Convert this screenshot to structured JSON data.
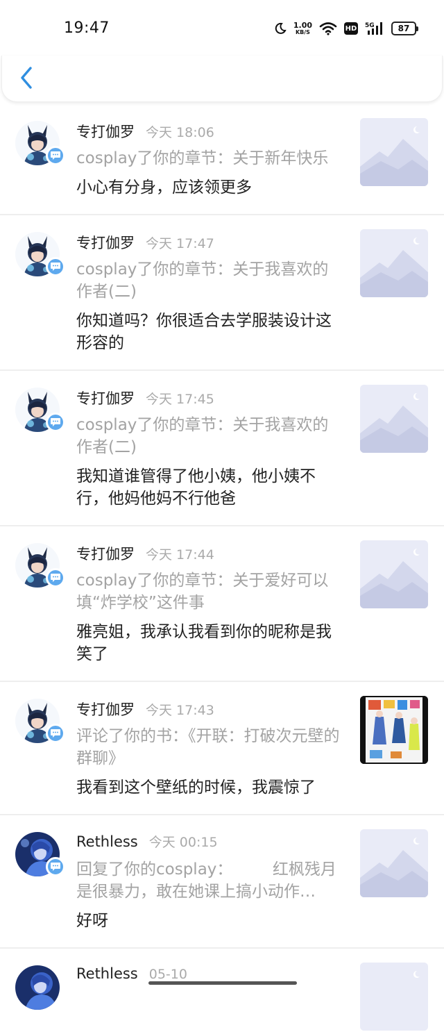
{
  "status_bar": {
    "time": "19:47",
    "net_speed_value": "1.00",
    "net_speed_unit": "KB/S",
    "hd": "HD",
    "signal": "5G",
    "battery": "87"
  },
  "notifications": [
    {
      "name": "专打伽罗",
      "time": "今天 18:06",
      "desc": "cosplay了你的章节：关于新年快乐",
      "message": "小心有分身，应该领更多",
      "avatar": "anime",
      "thumb": "placeholder"
    },
    {
      "name": "专打伽罗",
      "time": "今天 17:47",
      "desc": "cosplay了你的章节：关于我喜欢的作者(二)",
      "message": "你知道吗？你很适合去学服装设计这形容的",
      "avatar": "anime",
      "thumb": "placeholder"
    },
    {
      "name": "专打伽罗",
      "time": "今天 17:45",
      "desc": "cosplay了你的章节：关于我喜欢的作者(二)",
      "message": "我知道谁管得了他小姨，他小姨不行，他妈他妈不行他爸",
      "avatar": "anime",
      "thumb": "placeholder"
    },
    {
      "name": "专打伽罗",
      "time": "今天 17:44",
      "desc": "cosplay了你的章节：关于爱好可以填“炸学校”这件事",
      "message": "雅亮姐，我承认我看到你的昵称是我笑了",
      "avatar": "anime",
      "thumb": "placeholder"
    },
    {
      "name": "专打伽罗",
      "time": "今天 17:43",
      "desc": "评论了你的书：《开联：打破次元壁的群聊》",
      "message": "我看到这个壁纸的时候，我震惊了",
      "avatar": "anime",
      "thumb": "photo"
    },
    {
      "name": "Rethless",
      "time": "今天 00:15",
      "desc": "回复了你的cosplay：　　　红枫残月是很暴力，敢在她课上搞小动作…",
      "message": "好呀",
      "avatar": "blue",
      "thumb": "placeholder"
    },
    {
      "name": "Rethless",
      "time": "05-10",
      "desc": "",
      "message": "",
      "avatar": "blue",
      "thumb": "placeholder"
    }
  ],
  "colors": {
    "accent": "#2f8ee0",
    "badge": "#5ea9ee",
    "secondary_text": "#a3a3a3",
    "divider": "#eeeeee"
  }
}
